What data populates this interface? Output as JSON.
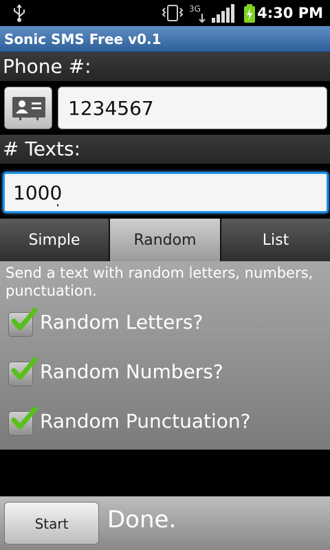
{
  "status_bar": {
    "time": "4:30 PM",
    "network_label": "3G",
    "icons": [
      "usb-icon",
      "vibrate-icon",
      "3g-data-icon",
      "signal-icon",
      "battery-charging-icon"
    ]
  },
  "app": {
    "title": "Sonic SMS Free v0.1"
  },
  "phone": {
    "label": "Phone #:",
    "value": "1234567"
  },
  "texts": {
    "label": "# Texts:",
    "value": "1000"
  },
  "tabs": [
    {
      "label": "Simple",
      "selected": false
    },
    {
      "label": "Random",
      "selected": true
    },
    {
      "label": "List",
      "selected": false
    }
  ],
  "random": {
    "description": "Send a text with random letters, numbers, punctuation.",
    "options": [
      {
        "label": "Random Letters?",
        "checked": true
      },
      {
        "label": "Random Numbers?",
        "checked": true
      },
      {
        "label": "Random Punctuation?",
        "checked": true
      }
    ]
  },
  "footer": {
    "start_label": "Start",
    "status": "Done."
  },
  "colors": {
    "title_bar": "#3f6fa8",
    "focus": "#1e90e6",
    "check": "#58c01a"
  }
}
